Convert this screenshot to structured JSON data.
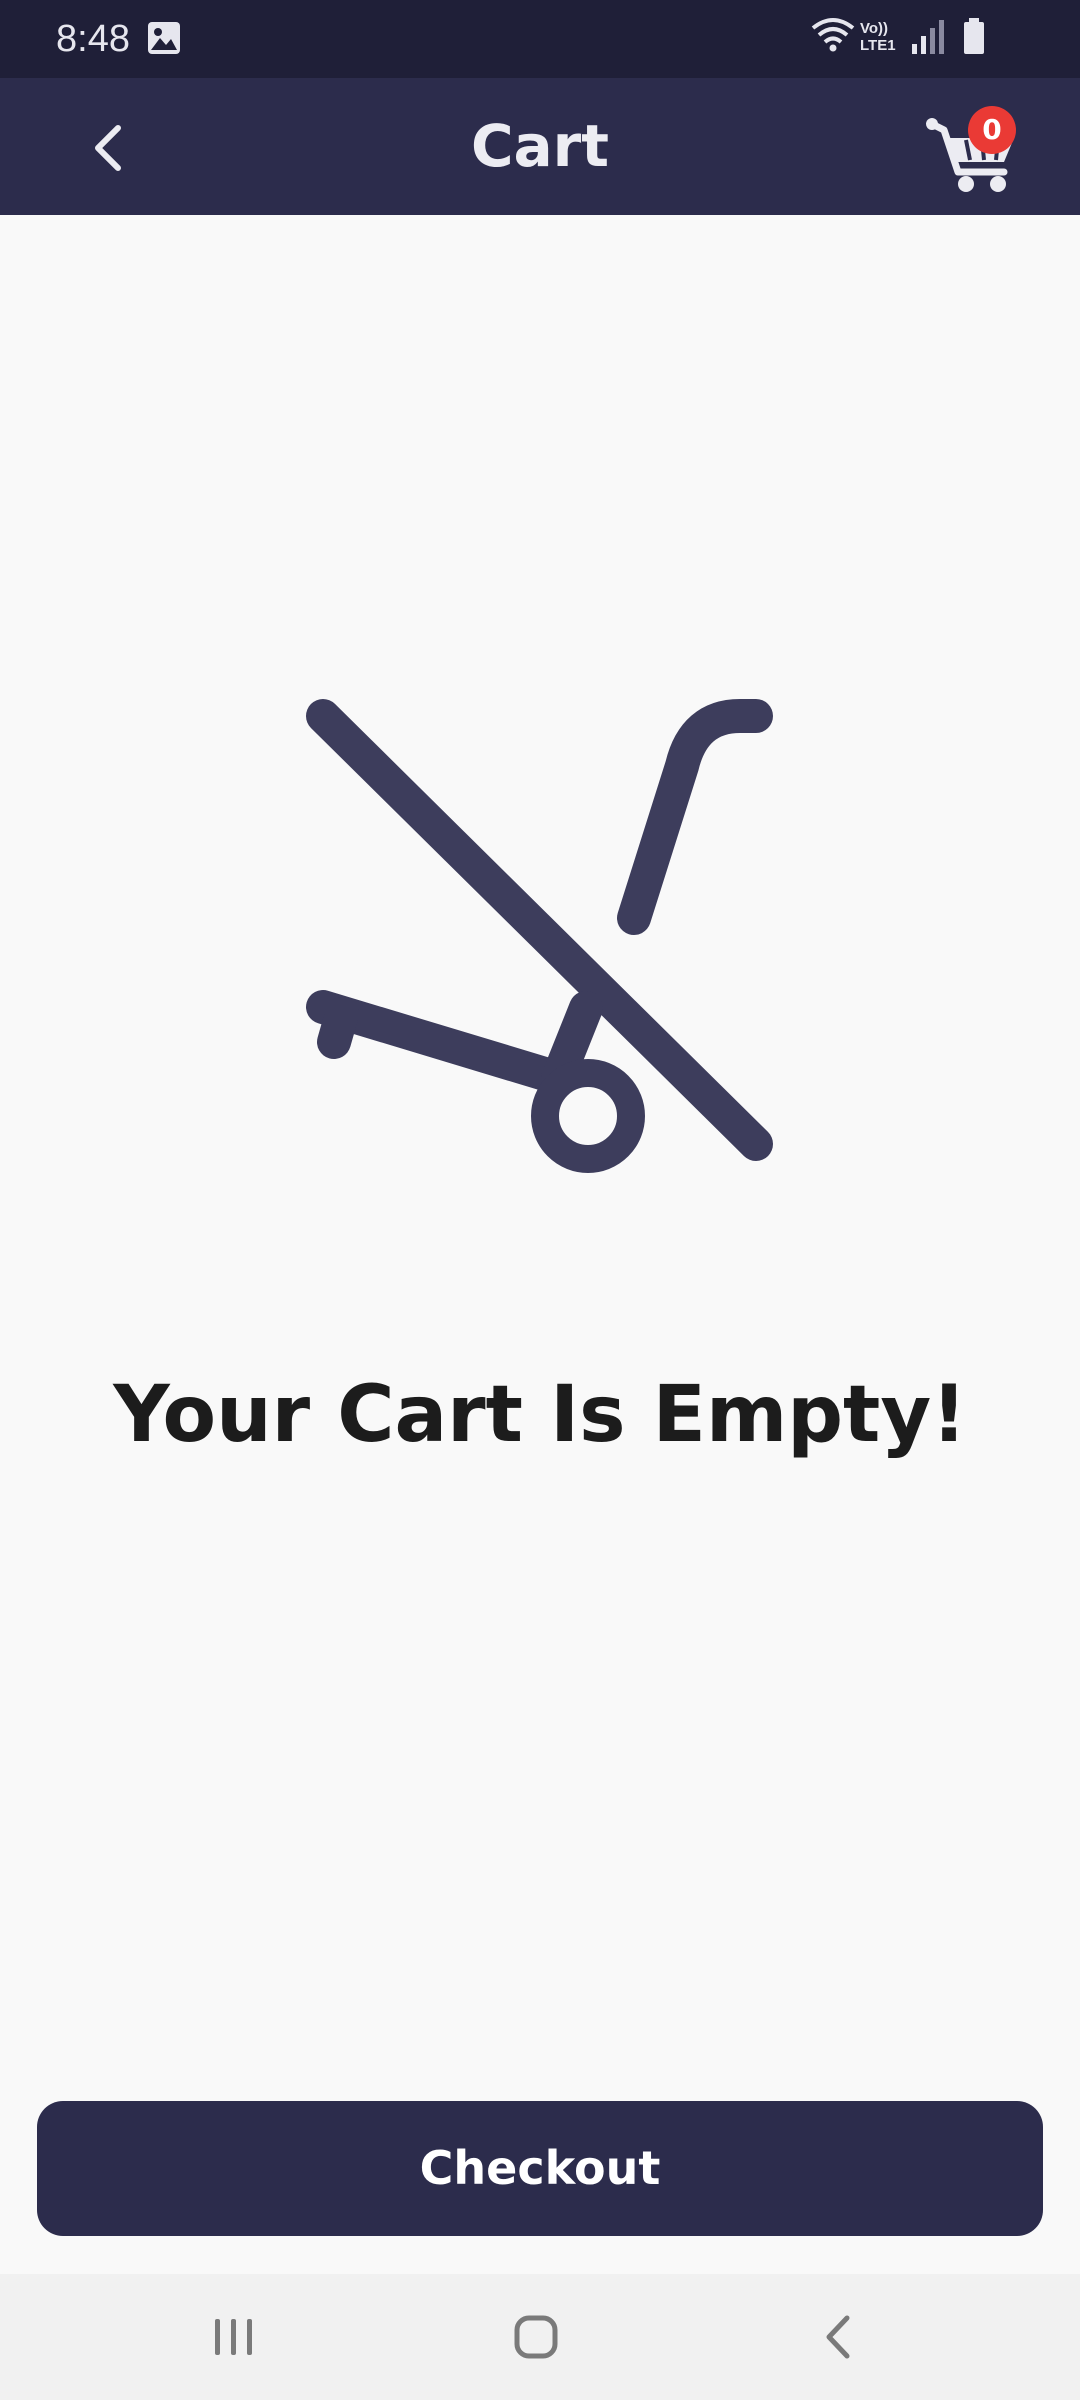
{
  "status_bar": {
    "time": "8:48",
    "icons": [
      "gallery-notification-icon",
      "wifi-icon",
      "volte-lte-icon",
      "signal-icon",
      "battery-icon"
    ],
    "lte_label_top": "Vo))",
    "lte_label_bottom": "LTE1"
  },
  "app_bar": {
    "title": "Cart",
    "back_icon": "chevron-left-icon",
    "cart_icon": "shopping-cart-icon",
    "cart_badge_count": "0"
  },
  "empty_state": {
    "illustration_icon": "cart-off-icon",
    "message": "Your Cart Is Empty!"
  },
  "checkout": {
    "label": "Checkout"
  },
  "navigation": {
    "items": [
      "recent-apps-icon",
      "home-icon",
      "back-icon"
    ]
  },
  "colors": {
    "status_bar": "#1f1f38",
    "app_bar": "#2c2c4c",
    "badge": "#ea3a35",
    "illustration": "#3d3d5c",
    "background": "#f9f9f9",
    "button": "#2c2c4c"
  }
}
